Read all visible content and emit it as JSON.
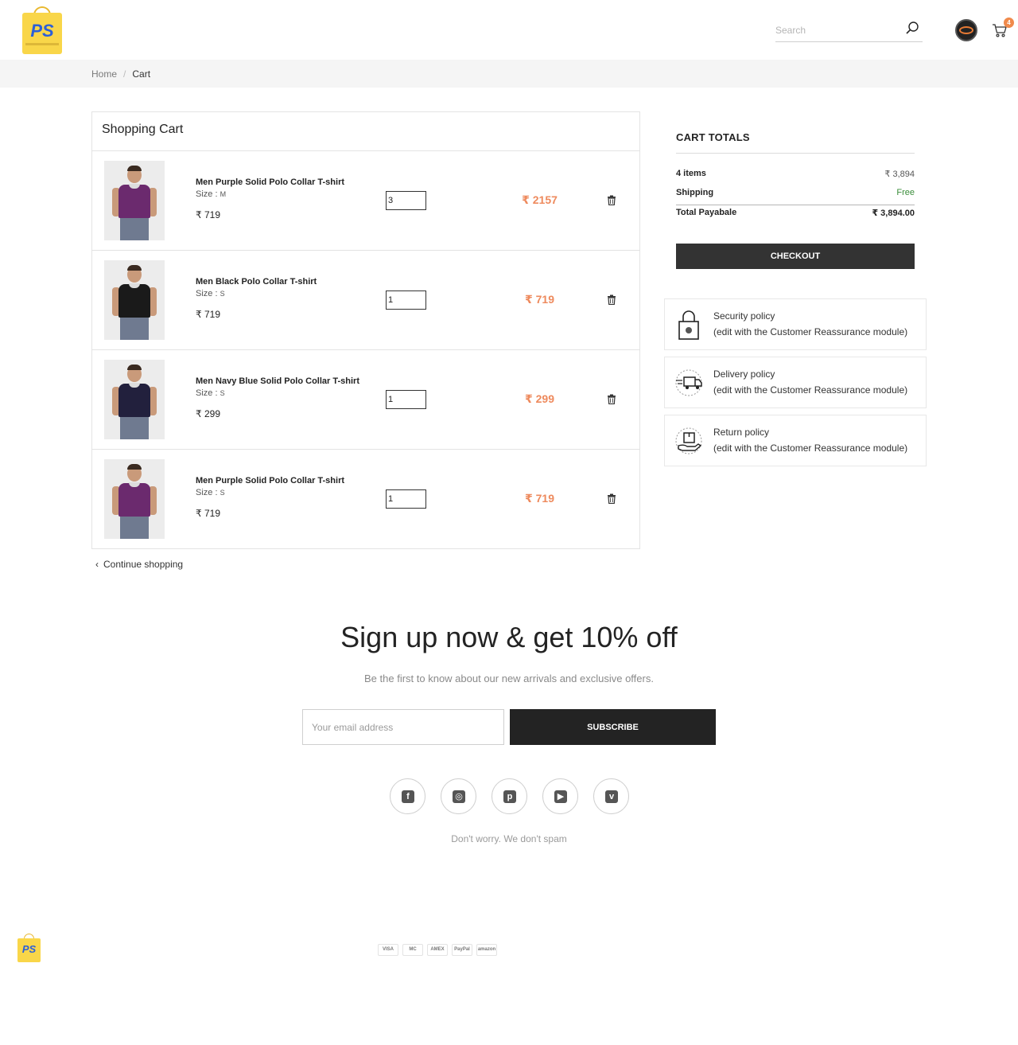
{
  "header": {
    "logo_text": "PS",
    "search_placeholder": "Search",
    "cart_count": "4"
  },
  "breadcrumb": {
    "home": "Home",
    "separator": "/",
    "current": "Cart"
  },
  "cart": {
    "title": "Shopping Cart",
    "items": [
      {
        "name": "Men Purple Solid Polo Collar T-shirt",
        "size_label": "Size :",
        "size": "M",
        "price": "₹ 719",
        "qty": "3",
        "total": "₹ 2157",
        "shirt_color": "#6b2a6e"
      },
      {
        "name": "Men Black Polo Collar T-shirt",
        "size_label": "Size :",
        "size": "S",
        "price": "₹ 719",
        "qty": "1",
        "total": "₹ 719",
        "shirt_color": "#1a1a1a"
      },
      {
        "name": "Men Navy Blue Solid Polo Collar T-shirt",
        "size_label": "Size :",
        "size": "S",
        "price": "₹ 299",
        "qty": "1",
        "total": "₹ 299",
        "shirt_color": "#22203d"
      },
      {
        "name": "Men Purple Solid Polo Collar T-shirt",
        "size_label": "Size :",
        "size": "S",
        "price": "₹ 719",
        "qty": "1",
        "total": "₹ 719",
        "shirt_color": "#6b2a6e"
      }
    ],
    "continue_label": "Continue shopping"
  },
  "totals": {
    "title": "CART TOTALS",
    "items_label": "4 items",
    "items_value": "₹ 3,894",
    "shipping_label": "Shipping",
    "shipping_value": "Free",
    "total_label": "Total Payabale",
    "total_value": "₹ 3,894.00",
    "checkout_label": "CHECKOUT"
  },
  "reassurance": [
    {
      "title": "Security policy",
      "desc": "(edit with the Customer Reassurance module)",
      "icon": "lock-icon"
    },
    {
      "title": "Delivery policy",
      "desc": "(edit with the Customer Reassurance module)",
      "icon": "delivery-truck-icon"
    },
    {
      "title": "Return policy",
      "desc": "(edit with the Customer Reassurance module)",
      "icon": "return-box-icon"
    }
  ],
  "newsletter": {
    "title": "Sign up now & get 10% off",
    "subtitle": "Be the first to know about our new arrivals and exclusive offers.",
    "email_placeholder": "Your email address",
    "button_label": "SUBSCRIBE",
    "spam_note": "Don't worry. We don't spam"
  },
  "social": [
    {
      "name": "facebook-icon",
      "glyph": "f"
    },
    {
      "name": "instagram-icon",
      "glyph": "◎"
    },
    {
      "name": "pinterest-icon",
      "glyph": "p"
    },
    {
      "name": "youtube-icon",
      "glyph": "▶"
    },
    {
      "name": "vimeo-icon",
      "glyph": "v"
    }
  ],
  "footer": {
    "logo_text": "PS",
    "payments": [
      "VISA",
      "MC",
      "AMEX",
      "PayPal",
      "amazon"
    ]
  },
  "colors": {
    "accent": "#ee8a5d",
    "dark_button": "#333333",
    "logo_yellow": "#f9d649",
    "logo_blue": "#2b5fd9",
    "free_green": "#3a8d3a"
  }
}
